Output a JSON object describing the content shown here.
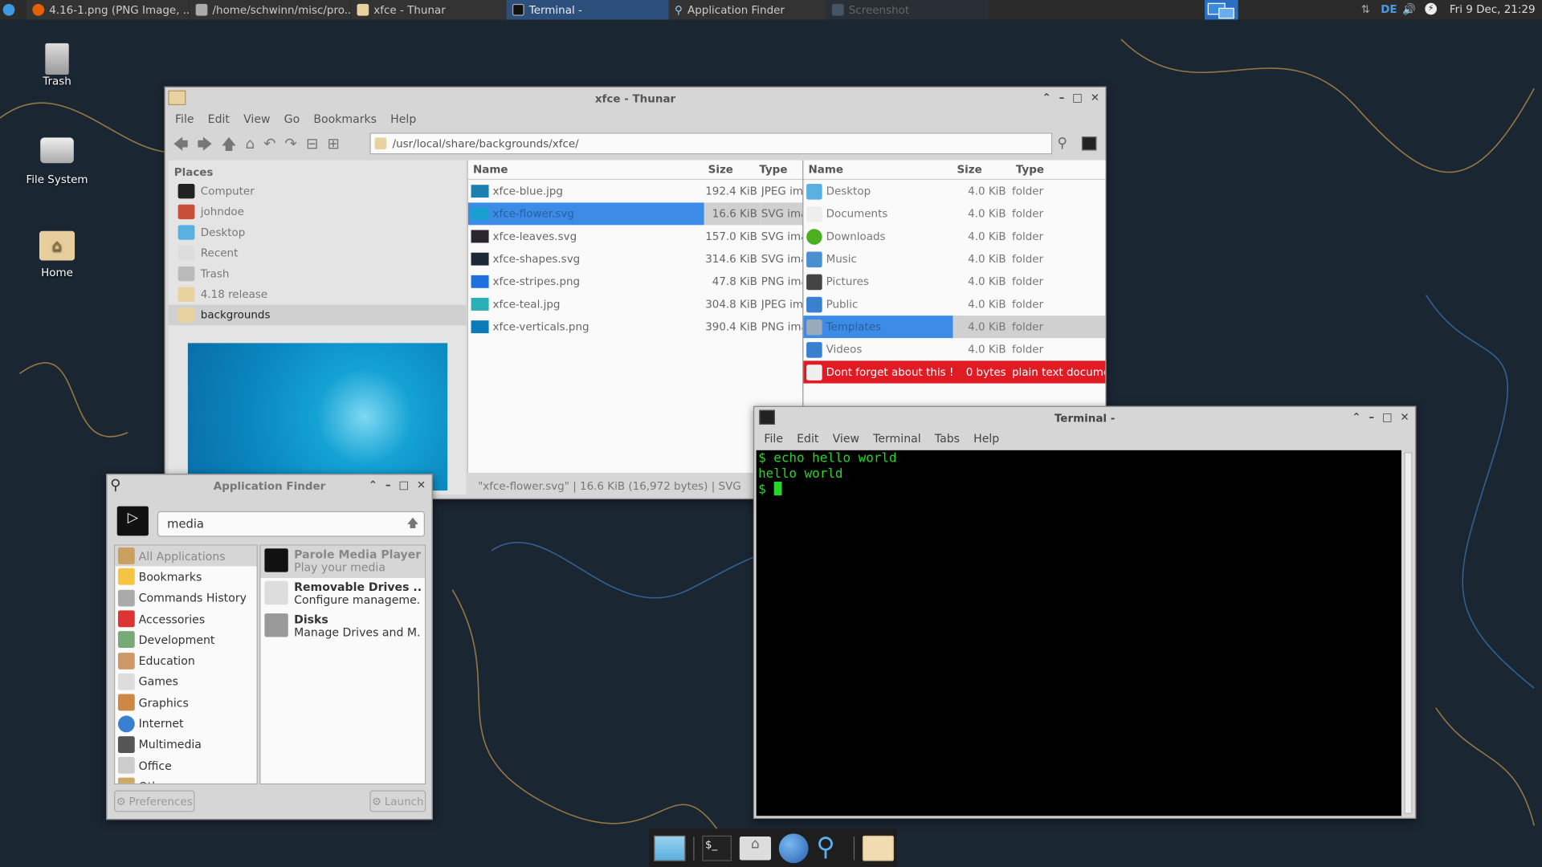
{
  "panel": {
    "tasks": [
      {
        "label": "4.16-1.png (PNG Image, ...",
        "icon": "firefox-icon"
      },
      {
        "label": "/home/schwinn/misc/pro...",
        "icon": "text-editor-icon"
      },
      {
        "label": "xfce - Thunar",
        "icon": "folder-icon"
      },
      {
        "label": "Terminal -",
        "icon": "terminal-icon",
        "active": true
      },
      {
        "label": "Application Finder",
        "icon": "search-icon"
      },
      {
        "label": "Screenshot",
        "icon": "screenshot-icon",
        "minimized": true
      }
    ],
    "keyboard_layout": "DE",
    "clock": "Fri  9 Dec, 21:29"
  },
  "desktop": {
    "icons": [
      "Trash",
      "File System",
      "Home"
    ]
  },
  "thunar": {
    "title": "xfce - Thunar",
    "menu": [
      "File",
      "Edit",
      "View",
      "Go",
      "Bookmarks",
      "Help"
    ],
    "path": "/usr/local/share/backgrounds/xfce/",
    "places_header": "Places",
    "places": [
      "Computer",
      "johndoe",
      "Desktop",
      "Recent",
      "Trash",
      "4.18 release",
      "backgrounds"
    ],
    "columns": [
      "Name",
      "Size",
      "Type"
    ],
    "files": [
      {
        "name": "xfce-blue.jpg",
        "size": "192.4  KiB",
        "type": "JPEG image",
        "color": "#1d7fb0"
      },
      {
        "name": "xfce-flower.svg",
        "size": "16.6  KiB",
        "type": "SVG image",
        "color": "#1aa0d0",
        "selected": true
      },
      {
        "name": "xfce-leaves.svg",
        "size": "157.0  KiB",
        "type": "SVG image",
        "color": "#2a2630"
      },
      {
        "name": "xfce-shapes.svg",
        "size": "314.6  KiB",
        "type": "SVG image",
        "color": "#1c2836"
      },
      {
        "name": "xfce-stripes.png",
        "size": "47.8  KiB",
        "type": "PNG image",
        "color": "#1f6fe0"
      },
      {
        "name": "xfce-teal.jpg",
        "size": "304.8  KiB",
        "type": "JPEG image",
        "color": "#2ab0b8"
      },
      {
        "name": "xfce-verticals.png",
        "size": "390.4  KiB",
        "type": "PNG image",
        "color": "#0a7ab8"
      }
    ],
    "folders": [
      {
        "name": "Desktop",
        "size": "4.0  KiB",
        "type": "folder"
      },
      {
        "name": "Documents",
        "size": "4.0  KiB",
        "type": "folder"
      },
      {
        "name": "Downloads",
        "size": "4.0  KiB",
        "type": "folder"
      },
      {
        "name": "Music",
        "size": "4.0  KiB",
        "type": "folder"
      },
      {
        "name": "Pictures",
        "size": "4.0  KiB",
        "type": "folder"
      },
      {
        "name": "Public",
        "size": "4.0  KiB",
        "type": "folder"
      },
      {
        "name": "Templates",
        "size": "4.0  KiB",
        "type": "folder",
        "selected": true
      },
      {
        "name": "Videos",
        "size": "4.0  KiB",
        "type": "folder"
      },
      {
        "name": "Dont forget about this !",
        "size": "0 bytes",
        "type": "plain text document",
        "highlight": "#e01b24"
      }
    ],
    "status": "\"xfce-flower.svg\"  |  16.6  KiB (16,972 bytes)  |  SVG"
  },
  "terminal": {
    "title": "Terminal -",
    "menu": [
      "File",
      "Edit",
      "View",
      "Terminal",
      "Tabs",
      "Help"
    ],
    "lines": [
      "$ echo hello world",
      "hello world",
      "$ "
    ]
  },
  "appfinder": {
    "title": "Application Finder",
    "search": "media",
    "categories": [
      "All Applications",
      "Bookmarks",
      "Commands History",
      "Accessories",
      "Development",
      "Education",
      "Games",
      "Graphics",
      "Internet",
      "Multimedia",
      "Office",
      "Other"
    ],
    "results": [
      {
        "name": "Parole Media Player",
        "desc": "Play your media"
      },
      {
        "name": "Removable Drives ...",
        "desc": "Configure manageme..."
      },
      {
        "name": "Disks",
        "desc": "Manage Drives and M..."
      }
    ],
    "preferences": "Preferences",
    "launch": "Launch"
  },
  "dock": [
    "show-desktop-icon",
    "terminal-icon",
    "home-folder-icon",
    "web-browser-icon",
    "app-finder-icon",
    "file-manager-icon"
  ]
}
